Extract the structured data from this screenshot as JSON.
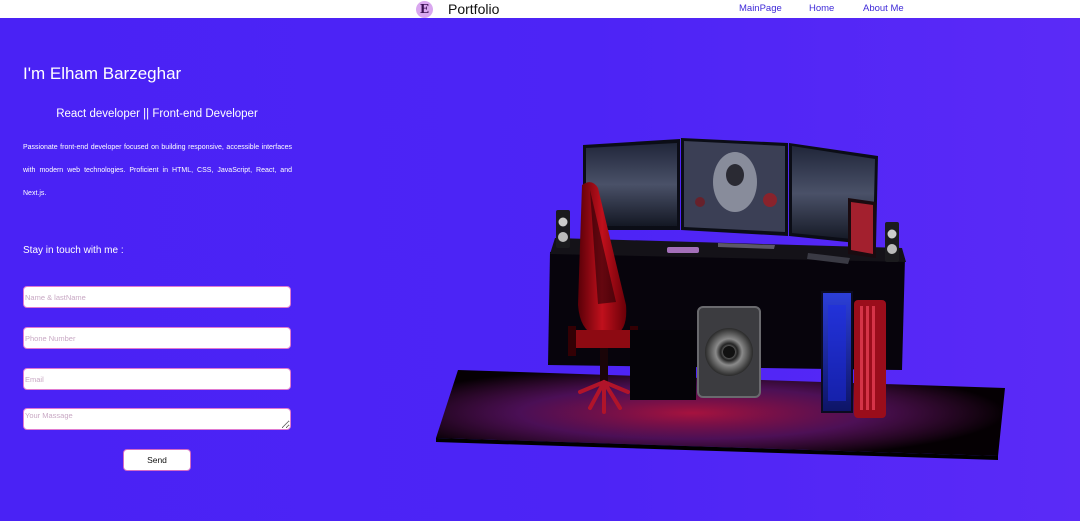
{
  "navbar": {
    "logo_letter": "E",
    "brand": "Portfolio",
    "links": [
      "MainPage",
      "Home",
      "About Me"
    ]
  },
  "hero": {
    "title": "I'm Elham Barzeghar",
    "subtitle": "React developer || Front-end Developer",
    "description": "Passionate front-end developer focused on building responsive, accessible interfaces with modern web technologies. Proficient in HTML, CSS, JavaScript, React, and Next.js."
  },
  "contact": {
    "heading": "Stay in touch with me :",
    "name_placeholder": "Name & lastName",
    "phone_placeholder": "Phone Number",
    "email_placeholder": "Email",
    "message_placeholder": "Your Massage",
    "send_label": "Send"
  },
  "colors": {
    "background": "#4a22f5",
    "nav_link": "#3f2ad8",
    "logo_bg": "#d9a7ef",
    "field_border": "#e07ad0"
  }
}
